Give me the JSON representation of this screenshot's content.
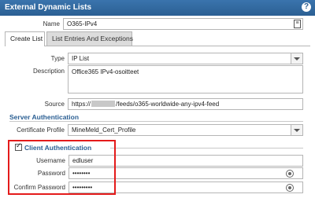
{
  "window": {
    "title": "External Dynamic Lists"
  },
  "name": {
    "label": "Name",
    "value": "O365-IPv4"
  },
  "tabs": [
    {
      "label": "Create List"
    },
    {
      "label": "List Entries And Exceptions"
    }
  ],
  "type": {
    "label": "Type",
    "value": "IP List"
  },
  "description": {
    "label": "Description",
    "value": "Office365 IPv4-osoitteet"
  },
  "source": {
    "label": "Source",
    "prefix": "https://",
    "suffix": "/feeds/o365-worldwide-any-ipv4-feed"
  },
  "server_auth": {
    "header": "Server Authentication",
    "cert_label": "Certificate Profile",
    "cert_value": "MineMeld_Cert_Profile"
  },
  "client_auth": {
    "header": "Client Authentication",
    "checked": true,
    "username_label": "Username",
    "username_value": "edluser",
    "password_label": "Password",
    "password_value": "••••••••",
    "confirm_label": "Confirm Password",
    "confirm_value": "•••••••••"
  },
  "colors": {
    "titlebar": "#2b5f93",
    "highlight": "#e41b1b",
    "section_header": "#2b5f93"
  }
}
